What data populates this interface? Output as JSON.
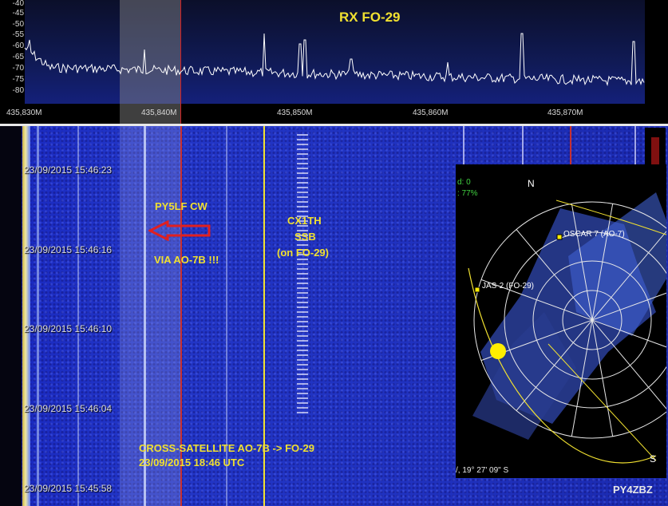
{
  "spectrum": {
    "title": "RX  FO-29",
    "y_ticks": [
      "-40",
      "-45",
      "-50",
      "-55",
      "-60",
      "-65",
      "-70",
      "-75",
      "-80"
    ],
    "x_ticks": [
      "435,830M",
      "435,840M",
      "435,850M",
      "435,860M",
      "435,870M"
    ],
    "accent_color": "#f0e030"
  },
  "waterfall": {
    "timestamps": [
      "23/09/2015 15:46:23",
      "23/09/2015 15:46:16",
      "23/09/2015 15:46:10",
      "23/09/2015 15:46:04",
      "23/09/2015 15:45:58"
    ],
    "annotations": {
      "cw_line1": "PY5LF CW",
      "cw_line2": "VIA  AO-7B !!!",
      "ssb_line1": "CX1TH",
      "ssb_line2": "SSB",
      "ssb_line3": "(on FO-29)",
      "cross_line1": "CROSS-SATELLITE    AO-7B -> FO-29",
      "cross_line2": "23/09/2015  18:46 UTC"
    }
  },
  "radar": {
    "top_left_1": "d: 0",
    "top_left_2": ": 77%",
    "north": "N",
    "south": "S",
    "sat1": "OSCAR 7 (AO-7)",
    "sat2": "JAS-2 (FO-29)",
    "coords": "/, 19° 27' 09\" S"
  },
  "footer": {
    "callsign": "PY4ZBZ"
  }
}
